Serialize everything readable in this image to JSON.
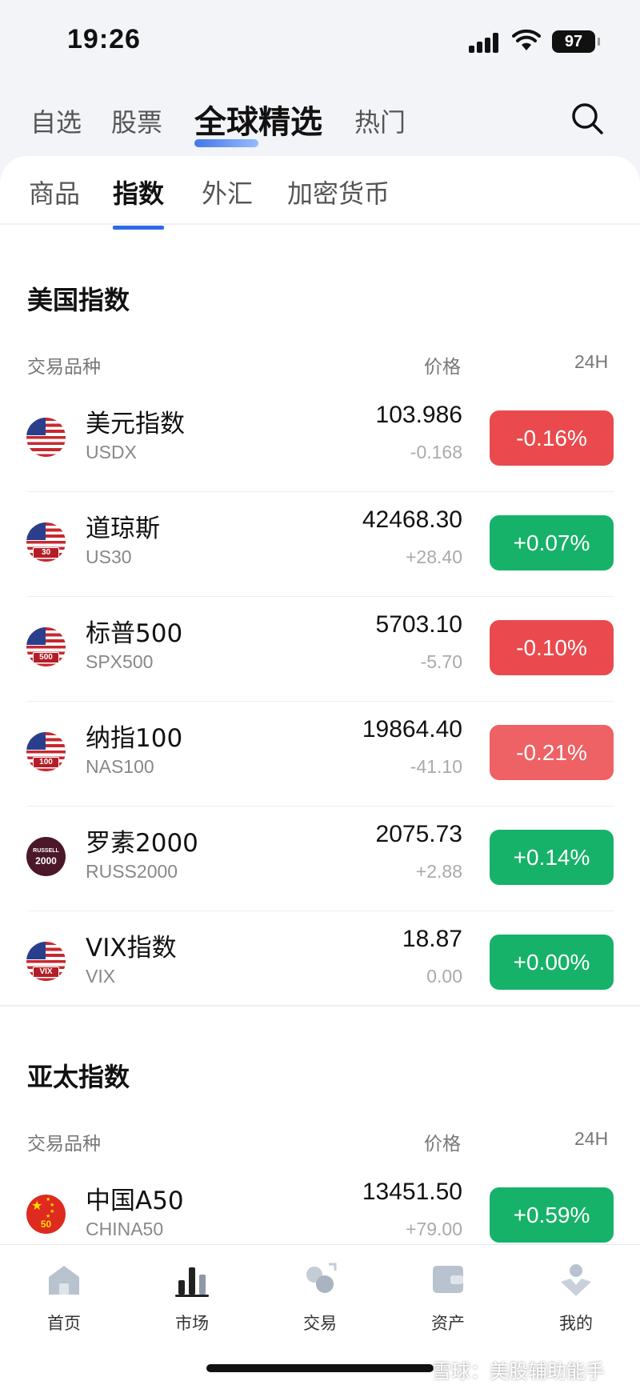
{
  "status_bar": {
    "time": "19:26",
    "battery": "97"
  },
  "top_tabs": [
    {
      "label": "自选"
    },
    {
      "label": "股票"
    },
    {
      "label": "全球精选",
      "active": true
    },
    {
      "label": "热门"
    }
  ],
  "sub_tabs": [
    {
      "label": "商品"
    },
    {
      "label": "指数",
      "active": true
    },
    {
      "label": "外汇"
    },
    {
      "label": "加密货币"
    }
  ],
  "columns": {
    "instrument": "交易品种",
    "price": "价格",
    "change": "24H"
  },
  "sections": [
    {
      "title": "美国指数",
      "rows": [
        {
          "name": "美元指数",
          "code": "USDX",
          "price": "103.986",
          "change": "-0.168",
          "pct": "-0.16%",
          "direction": "down",
          "flag": "us-flag-icon",
          "flag_tag": ""
        },
        {
          "name": "道琼斯",
          "code": "US30",
          "price": "42468.30",
          "change": "+28.40",
          "pct": "+0.07%",
          "direction": "up",
          "flag": "us-flag-icon",
          "flag_tag": "30"
        },
        {
          "name": "标普500",
          "code": "SPX500",
          "price": "5703.10",
          "change": "-5.70",
          "pct": "-0.10%",
          "direction": "down",
          "flag": "us-flag-icon",
          "flag_tag": "500"
        },
        {
          "name": "纳指100",
          "code": "NAS100",
          "price": "19864.40",
          "change": "-41.10",
          "pct": "-0.21%",
          "direction": "down",
          "flag": "us-flag-icon",
          "flag_tag": "100"
        },
        {
          "name": "罗素2000",
          "code": "RUSS2000",
          "price": "2075.73",
          "change": "+2.88",
          "pct": "+0.14%",
          "direction": "up",
          "flag": "russell-icon",
          "flag_tag": "RUSSELL 2000"
        },
        {
          "name": "VIX指数",
          "code": "VIX",
          "price": "18.87",
          "change": "0.00",
          "pct": "+0.00%",
          "direction": "up",
          "flag": "us-flag-icon",
          "flag_tag": "VIX"
        }
      ]
    },
    {
      "title": "亚太指数",
      "rows": [
        {
          "name": "中国A50",
          "code": "CHINA50",
          "price": "13451.50",
          "change": "+79.00",
          "pct": "+0.59%",
          "direction": "up",
          "flag": "cn-flag-icon",
          "flag_tag": "50"
        }
      ]
    }
  ],
  "bottom_nav": [
    {
      "label": "首页",
      "icon": "home-icon"
    },
    {
      "label": "市场",
      "icon": "market-icon",
      "active": true
    },
    {
      "label": "交易",
      "icon": "trade-icon"
    },
    {
      "label": "资产",
      "icon": "wallet-icon"
    },
    {
      "label": "我的",
      "icon": "profile-icon"
    }
  ],
  "watermark": "雪球：美股辅助能手",
  "colors": {
    "up": "#17b26a",
    "down": "#ea4a4d",
    "accent": "#2f6ae6"
  }
}
